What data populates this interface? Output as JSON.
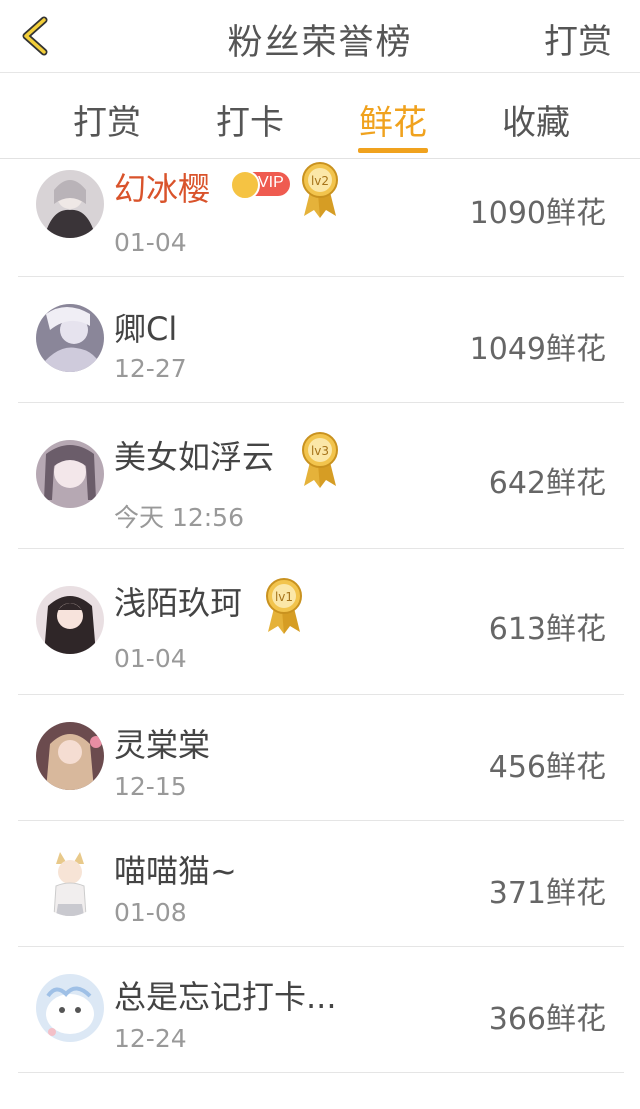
{
  "header": {
    "title": "粉丝荣誉榜",
    "action": "打赏"
  },
  "tabs": [
    "打赏",
    "打卡",
    "鲜花",
    "收藏"
  ],
  "active_tab": "鲜花",
  "rows": [
    {
      "name": "幻冰樱",
      "time": "01-04",
      "amount": "1090鲜花",
      "vip": true,
      "level": "lv2"
    },
    {
      "name": "卿Cl",
      "time": "12-27",
      "amount": "1049鲜花"
    },
    {
      "name": "美女如浮云",
      "time": "今天 12:56",
      "amount": "642鲜花",
      "level": "lv3"
    },
    {
      "name": "浅陌玖珂",
      "time": "01-04",
      "amount": "613鲜花",
      "level": "lv1"
    },
    {
      "name": "灵棠棠",
      "time": "12-15",
      "amount": "456鲜花"
    },
    {
      "name": "喵喵猫~",
      "time": "01-08",
      "amount": "371鲜花"
    },
    {
      "name": "总是忘记打卡...",
      "time": "12-24",
      "amount": "366鲜花"
    }
  ],
  "vip_label": "VIP",
  "colors": {
    "accent": "#f0a21e",
    "vip_name": "#d9532b"
  }
}
